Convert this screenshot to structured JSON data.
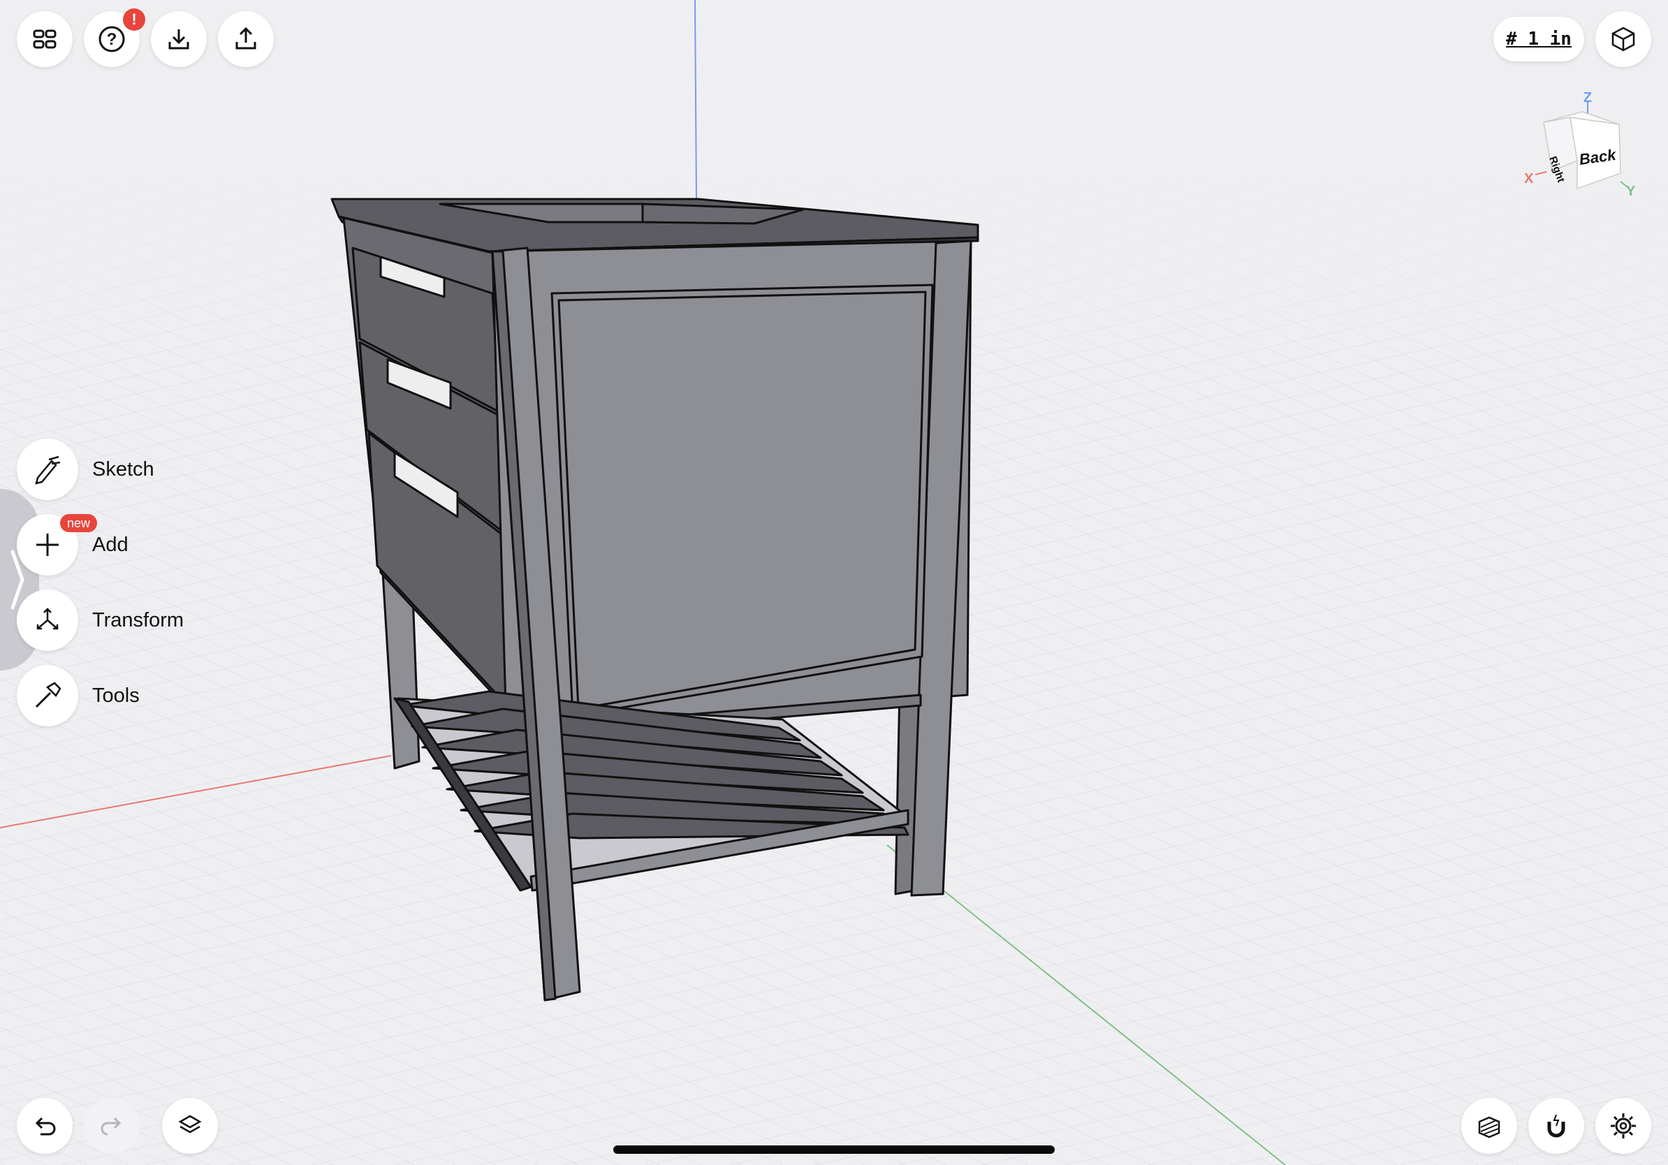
{
  "toolbar": {
    "units_label": "# 1 in",
    "help_badge": "!"
  },
  "tools": [
    {
      "label": "Sketch",
      "icon": "pencil-icon"
    },
    {
      "label": "Add",
      "icon": "plus-icon",
      "badge": "new"
    },
    {
      "label": "Transform",
      "icon": "transform-arrows-icon"
    },
    {
      "label": "Tools",
      "icon": "hammer-icon"
    }
  ],
  "view_cube": {
    "face_front": "Back",
    "face_side": "Right",
    "axis_x": "X",
    "axis_y": "Y",
    "axis_z": "Z"
  },
  "colors": {
    "x_axis": "#e87873",
    "y_axis": "#7fc08a",
    "z_axis": "#6e9ff0",
    "badge": "#e8453c",
    "model_face": "#8e8e95",
    "model_dark": "#616166"
  }
}
